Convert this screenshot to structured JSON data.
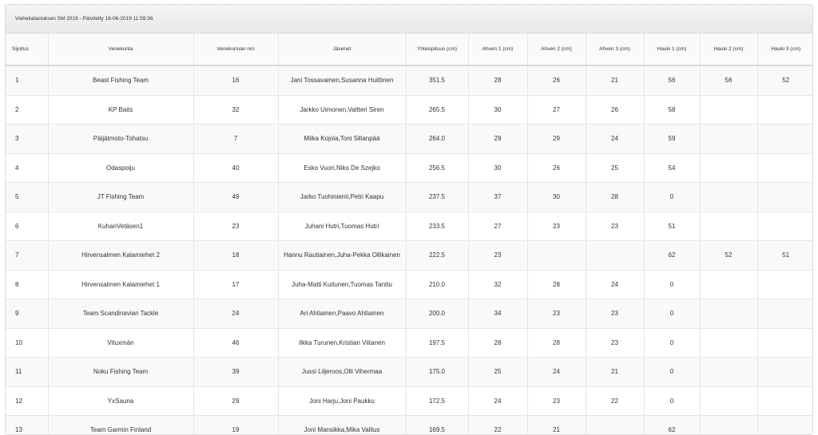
{
  "panel": {
    "title": "Viehekalastuksen SM 2019 - Päivitetty 16-06-2019 11:59:36"
  },
  "table": {
    "headers": [
      "Sijoitus",
      "Venekunta",
      "Venekunnan nro",
      "Jäsenet",
      "Yhteispituus (cm)",
      "Ahven 1 (cm)",
      "Ahven 2 (cm)",
      "Ahven 3 (cm)",
      "Hauki 1 (cm)",
      "Hauki 2 (cm)",
      "Hauki 3 (cm)"
    ],
    "rows": [
      [
        "1",
        "Beast Fishing Team",
        "16",
        "Jani Tossavainen,Susanna Huittinen",
        "351.5",
        "28",
        "26",
        "21",
        "56",
        "56",
        "52"
      ],
      [
        "2",
        "KP Baits",
        "32",
        "Jarkko Uimonen,Valtteri Siren",
        "265.5",
        "30",
        "27",
        "26",
        "58",
        "",
        ""
      ],
      [
        "3",
        "Päijätmoto-Tohatsu",
        "7",
        "Miika Kojola,Toni Sillanpää",
        "264.0",
        "29",
        "29",
        "24",
        "59",
        "",
        ""
      ],
      [
        "4",
        "Odaspoiju",
        "40",
        "Esko Vuori,Niko De Szejko",
        "256.5",
        "30",
        "26",
        "25",
        "54",
        "",
        ""
      ],
      [
        "5",
        "JT Fishing Team",
        "49",
        "Jarko Tuohiniemi,Petri Kaapu",
        "237.5",
        "37",
        "30",
        "28",
        "0",
        "",
        ""
      ],
      [
        "6",
        "KuhanVetäsen1",
        "23",
        "Juhani Hutri,Tuomas Hutri",
        "233.5",
        "27",
        "23",
        "23",
        "51",
        "",
        ""
      ],
      [
        "7",
        "Hirvensalmen Kalamiehet 2",
        "18",
        "Hannu Rautiainen,Juha-Pekka Ollikainen",
        "222.5",
        "23",
        "",
        "",
        "62",
        "52",
        "51"
      ],
      [
        "8",
        "Hirvensalmen Kalamiehet 1",
        "17",
        "Juha-Matti Kuitunen,Tuomas Tanttu",
        "210.0",
        "32",
        "28",
        "24",
        "0",
        "",
        ""
      ],
      [
        "9",
        "Team Scandinavian Tackle",
        "24",
        "Ari Ahtiainen,Paavo Ahtiainen",
        "200.0",
        "34",
        "23",
        "23",
        "0",
        "",
        ""
      ],
      [
        "10",
        "Vituxmän",
        "46",
        "Ilkka Turunen,Kristian Viitanen",
        "197.5",
        "28",
        "28",
        "23",
        "0",
        "",
        ""
      ],
      [
        "11",
        "Noku Fishing Team",
        "39",
        "Jussi Liljeroos,Olli Vihermaa",
        "175.0",
        "25",
        "24",
        "21",
        "0",
        "",
        ""
      ],
      [
        "12",
        "YxSauna",
        "29",
        "Joni Harju,Joni Paukku",
        "172.5",
        "24",
        "23",
        "22",
        "0",
        "",
        ""
      ],
      [
        "13",
        "Team Garmin Finland",
        "19",
        "Joni Mansikka,Mika Vallius",
        "169.5",
        "22",
        "21",
        "",
        "62",
        "",
        ""
      ]
    ]
  }
}
